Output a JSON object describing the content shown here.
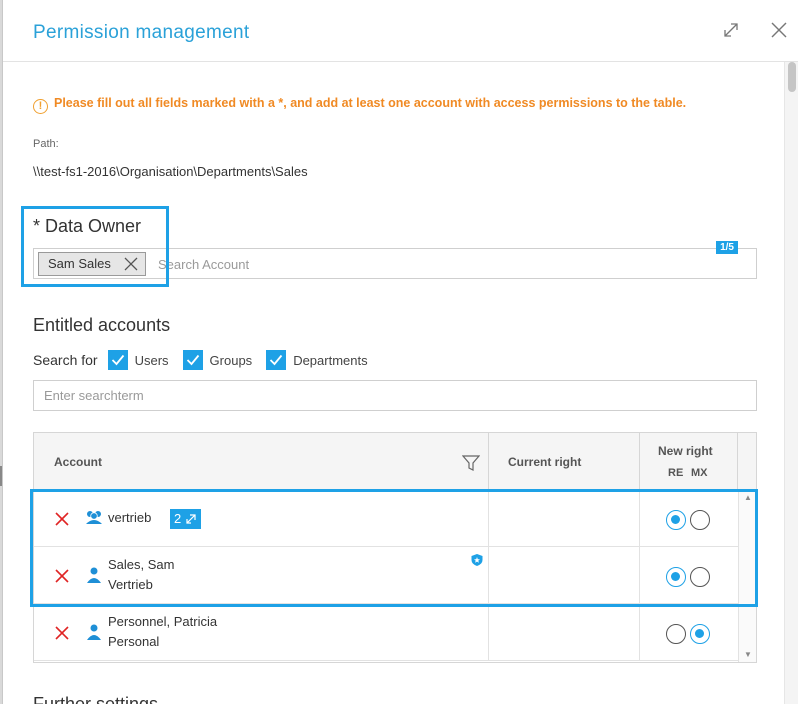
{
  "dialog": {
    "title": "Permission management",
    "expand_icon": "expand-icon",
    "close_icon": "close-icon"
  },
  "warning": {
    "text": "Please fill out all fields marked with a *, and add at least one account with access permissions to the table.",
    "icon": "!"
  },
  "path": {
    "label": "Path:",
    "value": "\\\\test-fs1-2016\\Organisation\\Departments\\Sales"
  },
  "data_owner": {
    "title": "* Data Owner",
    "tag": "Sam Sales",
    "placeholder": "Search Account",
    "badge": "1/5"
  },
  "entitled": {
    "title": "Entitled accounts",
    "search_for_label": "Search for",
    "filters": [
      {
        "label": "Users",
        "checked": true
      },
      {
        "label": "Groups",
        "checked": true
      },
      {
        "label": "Departments",
        "checked": true
      }
    ],
    "search_placeholder": "Enter searchterm"
  },
  "table": {
    "headers": {
      "account": "Account",
      "current_right": "Current right",
      "new_right": "New right",
      "re": "RE",
      "mx": "MX"
    },
    "rows": [
      {
        "name": "vertrieb",
        "line2": "",
        "type": "group",
        "count": "2",
        "current": "",
        "re": true,
        "mx": false
      },
      {
        "name": "Sales, Sam",
        "line2": "Vertrieb",
        "type": "user",
        "owner": true,
        "current": "",
        "re": true,
        "mx": false
      },
      {
        "name": "Personnel, Patricia",
        "line2": "Personal",
        "type": "user",
        "current": "",
        "re": false,
        "mx": true
      }
    ]
  },
  "further": {
    "title": "Further settings"
  },
  "colors": {
    "accent": "#1ea1e6",
    "warning": "#f08a24",
    "delete": "#e02424"
  }
}
